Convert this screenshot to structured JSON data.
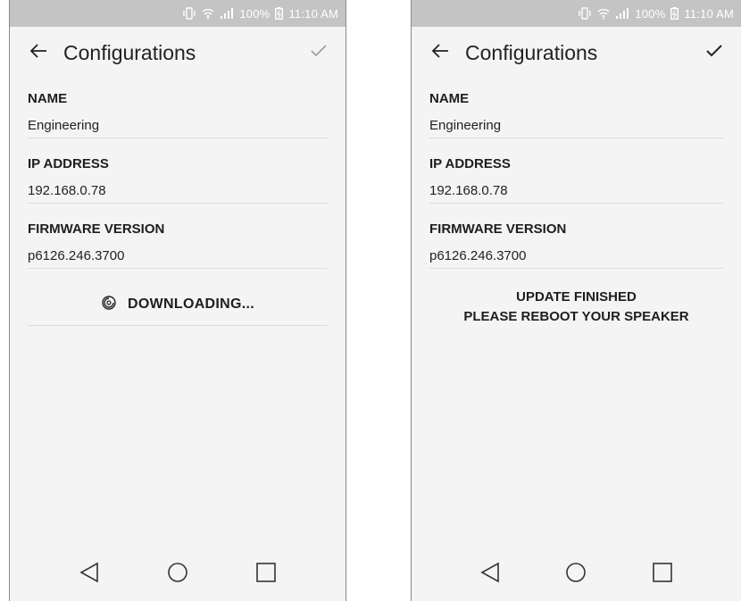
{
  "status_bar": {
    "battery": "100%",
    "time": "11:10 AM"
  },
  "screens": [
    {
      "title": "Configurations",
      "fields": [
        {
          "label": "NAME",
          "value": "Engineering"
        },
        {
          "label": "IP ADDRESS",
          "value": "192.168.0.78"
        },
        {
          "label": "FIRMWARE VERSION",
          "value": "p6126.246.3700"
        }
      ],
      "status_text": "DOWNLOADING...",
      "confirm_enabled": false
    },
    {
      "title": "Configurations",
      "fields": [
        {
          "label": "NAME",
          "value": "Engineering"
        },
        {
          "label": "IP ADDRESS",
          "value": "192.168.0.78"
        },
        {
          "label": "FIRMWARE VERSION",
          "value": "p6126.246.3700"
        }
      ],
      "message_line1": "UPDATE FINISHED",
      "message_line2": "PLEASE REBOOT YOUR SPEAKER",
      "confirm_enabled": true
    }
  ],
  "icons": {
    "back": "arrow-left-icon",
    "confirm": "checkmark-icon",
    "nav_back": "triangle-back-icon",
    "nav_home": "circle-home-icon",
    "nav_recents": "square-recents-icon"
  },
  "colors": {
    "status_bar": "#c4c4c4",
    "background": "#f4f4f4",
    "text": "#222222",
    "confirm_disabled": "#9a9a9a",
    "confirm_enabled": "#222222"
  }
}
